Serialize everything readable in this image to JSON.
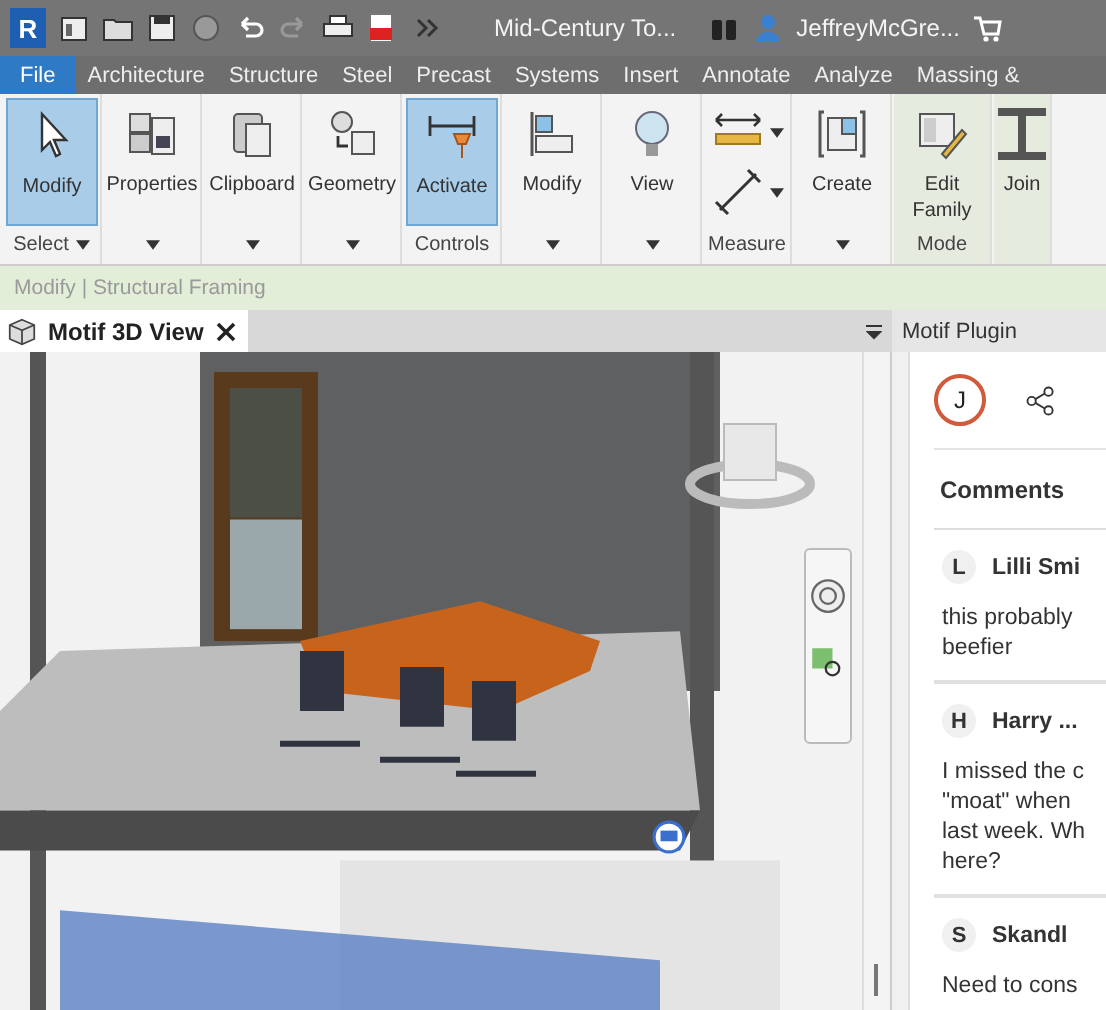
{
  "app": {
    "logo": "R",
    "title": "Mid-Century To...",
    "user": "JeffreyMcGre..."
  },
  "tabs": [
    {
      "label": "File",
      "selected": true
    },
    {
      "label": "Architecture",
      "selected": false
    },
    {
      "label": "Structure",
      "selected": false
    },
    {
      "label": "Steel",
      "selected": false
    },
    {
      "label": "Precast",
      "selected": false
    },
    {
      "label": "Systems",
      "selected": false
    },
    {
      "label": "Insert",
      "selected": false
    },
    {
      "label": "Annotate",
      "selected": false
    },
    {
      "label": "Analyze",
      "selected": false
    },
    {
      "label": "Massing &",
      "selected": false
    }
  ],
  "ribbon": {
    "panels": [
      {
        "label": "Select",
        "dropdown": true,
        "tinted": false,
        "buttons": [
          {
            "kind": "large",
            "label": "Modify",
            "selected": true
          }
        ]
      },
      {
        "dropdown": true,
        "tinted": false,
        "buttons": [
          {
            "kind": "large",
            "label": "Properties",
            "selected": false
          }
        ]
      },
      {
        "dropdown": true,
        "tinted": false,
        "buttons": [
          {
            "kind": "large",
            "label": "Clipboard",
            "selected": false
          }
        ]
      },
      {
        "dropdown": true,
        "tinted": false,
        "buttons": [
          {
            "kind": "large",
            "label": "Geometry",
            "selected": false
          }
        ]
      },
      {
        "label": "Controls",
        "dropdown": false,
        "tinted": false,
        "buttons": [
          {
            "kind": "large",
            "label": "Activate",
            "selected": true
          }
        ]
      },
      {
        "dropdown": true,
        "tinted": false,
        "buttons": [
          {
            "kind": "large",
            "label": "Modify",
            "selected": false
          }
        ]
      },
      {
        "dropdown": true,
        "tinted": false,
        "buttons": [
          {
            "kind": "large",
            "label": "View",
            "selected": false
          }
        ]
      },
      {
        "label": "Measure",
        "dropdown": false,
        "tinted": false,
        "buttons": [
          {
            "kind": "small",
            "selected": false
          },
          {
            "kind": "small",
            "selected": false
          }
        ]
      },
      {
        "dropdown": true,
        "tinted": false,
        "buttons": [
          {
            "kind": "large",
            "label": "Create",
            "selected": false
          }
        ]
      },
      {
        "label": "Mode",
        "dropdown": false,
        "tinted": true,
        "buttons": [
          {
            "kind": "large",
            "label": "Edit Family",
            "selected": false
          }
        ]
      },
      {
        "dropdown": false,
        "tinted": true,
        "buttons": [
          {
            "kind": "large",
            "label": "Join",
            "selected": false
          }
        ]
      }
    ]
  },
  "context_bar": "Modify | Structural Framing",
  "view_tab": {
    "title": "Motif 3D View"
  },
  "plugin": {
    "title": "Motif Plugin",
    "user_initial": "J",
    "section": "Comments",
    "comments": [
      {
        "initial": "L",
        "author": "Lilli Smi",
        "lines": [
          "this probably",
          "beefier"
        ]
      },
      {
        "initial": "H",
        "author": "Harry ...",
        "lines": [
          "I missed the c",
          "\"moat\" when",
          "last week. Wh",
          "here?"
        ]
      },
      {
        "initial": "S",
        "author": "Skandl",
        "lines": [
          "Need to cons"
        ]
      }
    ]
  }
}
